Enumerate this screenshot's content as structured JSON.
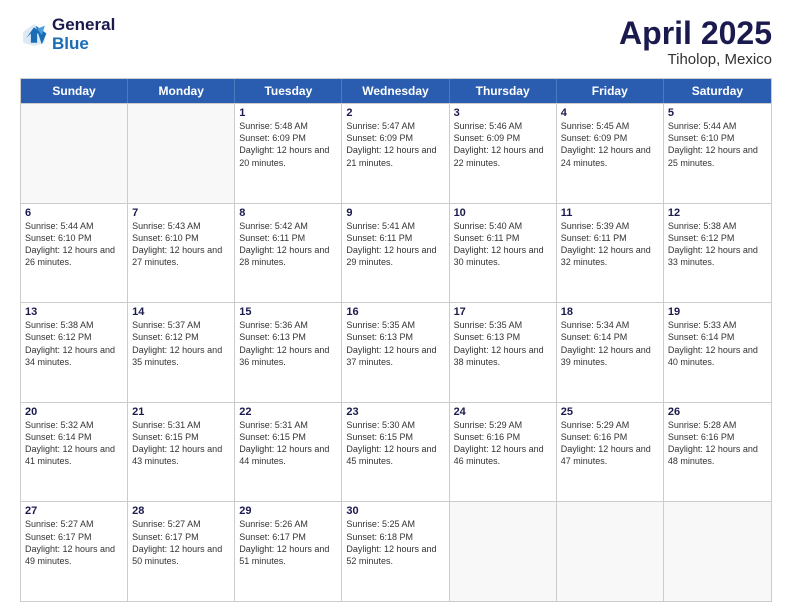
{
  "logo": {
    "line1": "General",
    "line2": "Blue"
  },
  "title": "April 2025",
  "subtitle": "Tiholop, Mexico",
  "days": [
    "Sunday",
    "Monday",
    "Tuesday",
    "Wednesday",
    "Thursday",
    "Friday",
    "Saturday"
  ],
  "weeks": [
    [
      {
        "day": "",
        "sunrise": "",
        "sunset": "",
        "daylight": ""
      },
      {
        "day": "",
        "sunrise": "",
        "sunset": "",
        "daylight": ""
      },
      {
        "day": "1",
        "sunrise": "Sunrise: 5:48 AM",
        "sunset": "Sunset: 6:09 PM",
        "daylight": "Daylight: 12 hours and 20 minutes."
      },
      {
        "day": "2",
        "sunrise": "Sunrise: 5:47 AM",
        "sunset": "Sunset: 6:09 PM",
        "daylight": "Daylight: 12 hours and 21 minutes."
      },
      {
        "day": "3",
        "sunrise": "Sunrise: 5:46 AM",
        "sunset": "Sunset: 6:09 PM",
        "daylight": "Daylight: 12 hours and 22 minutes."
      },
      {
        "day": "4",
        "sunrise": "Sunrise: 5:45 AM",
        "sunset": "Sunset: 6:09 PM",
        "daylight": "Daylight: 12 hours and 24 minutes."
      },
      {
        "day": "5",
        "sunrise": "Sunrise: 5:44 AM",
        "sunset": "Sunset: 6:10 PM",
        "daylight": "Daylight: 12 hours and 25 minutes."
      }
    ],
    [
      {
        "day": "6",
        "sunrise": "Sunrise: 5:44 AM",
        "sunset": "Sunset: 6:10 PM",
        "daylight": "Daylight: 12 hours and 26 minutes."
      },
      {
        "day": "7",
        "sunrise": "Sunrise: 5:43 AM",
        "sunset": "Sunset: 6:10 PM",
        "daylight": "Daylight: 12 hours and 27 minutes."
      },
      {
        "day": "8",
        "sunrise": "Sunrise: 5:42 AM",
        "sunset": "Sunset: 6:11 PM",
        "daylight": "Daylight: 12 hours and 28 minutes."
      },
      {
        "day": "9",
        "sunrise": "Sunrise: 5:41 AM",
        "sunset": "Sunset: 6:11 PM",
        "daylight": "Daylight: 12 hours and 29 minutes."
      },
      {
        "day": "10",
        "sunrise": "Sunrise: 5:40 AM",
        "sunset": "Sunset: 6:11 PM",
        "daylight": "Daylight: 12 hours and 30 minutes."
      },
      {
        "day": "11",
        "sunrise": "Sunrise: 5:39 AM",
        "sunset": "Sunset: 6:11 PM",
        "daylight": "Daylight: 12 hours and 32 minutes."
      },
      {
        "day": "12",
        "sunrise": "Sunrise: 5:38 AM",
        "sunset": "Sunset: 6:12 PM",
        "daylight": "Daylight: 12 hours and 33 minutes."
      }
    ],
    [
      {
        "day": "13",
        "sunrise": "Sunrise: 5:38 AM",
        "sunset": "Sunset: 6:12 PM",
        "daylight": "Daylight: 12 hours and 34 minutes."
      },
      {
        "day": "14",
        "sunrise": "Sunrise: 5:37 AM",
        "sunset": "Sunset: 6:12 PM",
        "daylight": "Daylight: 12 hours and 35 minutes."
      },
      {
        "day": "15",
        "sunrise": "Sunrise: 5:36 AM",
        "sunset": "Sunset: 6:13 PM",
        "daylight": "Daylight: 12 hours and 36 minutes."
      },
      {
        "day": "16",
        "sunrise": "Sunrise: 5:35 AM",
        "sunset": "Sunset: 6:13 PM",
        "daylight": "Daylight: 12 hours and 37 minutes."
      },
      {
        "day": "17",
        "sunrise": "Sunrise: 5:35 AM",
        "sunset": "Sunset: 6:13 PM",
        "daylight": "Daylight: 12 hours and 38 minutes."
      },
      {
        "day": "18",
        "sunrise": "Sunrise: 5:34 AM",
        "sunset": "Sunset: 6:14 PM",
        "daylight": "Daylight: 12 hours and 39 minutes."
      },
      {
        "day": "19",
        "sunrise": "Sunrise: 5:33 AM",
        "sunset": "Sunset: 6:14 PM",
        "daylight": "Daylight: 12 hours and 40 minutes."
      }
    ],
    [
      {
        "day": "20",
        "sunrise": "Sunrise: 5:32 AM",
        "sunset": "Sunset: 6:14 PM",
        "daylight": "Daylight: 12 hours and 41 minutes."
      },
      {
        "day": "21",
        "sunrise": "Sunrise: 5:31 AM",
        "sunset": "Sunset: 6:15 PM",
        "daylight": "Daylight: 12 hours and 43 minutes."
      },
      {
        "day": "22",
        "sunrise": "Sunrise: 5:31 AM",
        "sunset": "Sunset: 6:15 PM",
        "daylight": "Daylight: 12 hours and 44 minutes."
      },
      {
        "day": "23",
        "sunrise": "Sunrise: 5:30 AM",
        "sunset": "Sunset: 6:15 PM",
        "daylight": "Daylight: 12 hours and 45 minutes."
      },
      {
        "day": "24",
        "sunrise": "Sunrise: 5:29 AM",
        "sunset": "Sunset: 6:16 PM",
        "daylight": "Daylight: 12 hours and 46 minutes."
      },
      {
        "day": "25",
        "sunrise": "Sunrise: 5:29 AM",
        "sunset": "Sunset: 6:16 PM",
        "daylight": "Daylight: 12 hours and 47 minutes."
      },
      {
        "day": "26",
        "sunrise": "Sunrise: 5:28 AM",
        "sunset": "Sunset: 6:16 PM",
        "daylight": "Daylight: 12 hours and 48 minutes."
      }
    ],
    [
      {
        "day": "27",
        "sunrise": "Sunrise: 5:27 AM",
        "sunset": "Sunset: 6:17 PM",
        "daylight": "Daylight: 12 hours and 49 minutes."
      },
      {
        "day": "28",
        "sunrise": "Sunrise: 5:27 AM",
        "sunset": "Sunset: 6:17 PM",
        "daylight": "Daylight: 12 hours and 50 minutes."
      },
      {
        "day": "29",
        "sunrise": "Sunrise: 5:26 AM",
        "sunset": "Sunset: 6:17 PM",
        "daylight": "Daylight: 12 hours and 51 minutes."
      },
      {
        "day": "30",
        "sunrise": "Sunrise: 5:25 AM",
        "sunset": "Sunset: 6:18 PM",
        "daylight": "Daylight: 12 hours and 52 minutes."
      },
      {
        "day": "",
        "sunrise": "",
        "sunset": "",
        "daylight": ""
      },
      {
        "day": "",
        "sunrise": "",
        "sunset": "",
        "daylight": ""
      },
      {
        "day": "",
        "sunrise": "",
        "sunset": "",
        "daylight": ""
      }
    ]
  ]
}
